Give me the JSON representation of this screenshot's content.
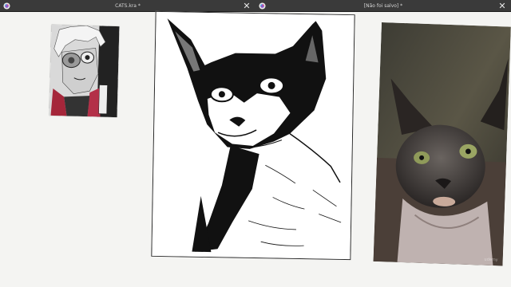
{
  "windows": [
    {
      "title": "CATS.kra *",
      "close_glyph": "✕"
    },
    {
      "title": "[Não foi salvo] *",
      "close_glyph": "✕"
    }
  ],
  "icons": {
    "app": "krita-app-icon",
    "close": "close-icon"
  },
  "watermark": "udemy",
  "colors": {
    "titlebar": "#3a3a3a",
    "canvas_background": "#f3f3f1",
    "ink": "#111111"
  }
}
